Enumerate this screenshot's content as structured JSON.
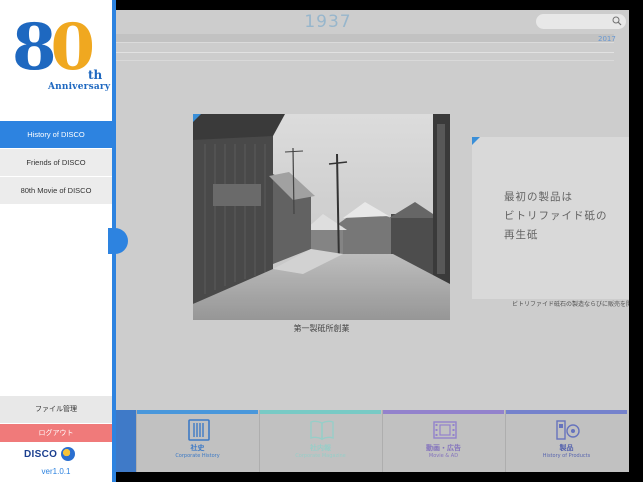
{
  "timeline": {
    "year": "1937",
    "end_year": "2017"
  },
  "photo": {
    "caption": "第一製砥所創業"
  },
  "card": {
    "lines": [
      "最初の製品は",
      "ビトリファイド砥の",
      "再生砥"
    ],
    "subtext": "ビトリファイド砥石の製造ならびに販売を開"
  },
  "tabs": [
    {
      "jp": "社史",
      "en": "Corporate History",
      "icon": "book-icon",
      "color": "#3a8fd8"
    },
    {
      "jp": "社内報",
      "en": "Corporate Magazine",
      "icon": "open-book-icon",
      "color": "#6dc6c0"
    },
    {
      "jp": "動画・広告",
      "en": "Movie & AD",
      "icon": "film-icon",
      "color": "#8a78c8"
    },
    {
      "jp": "製品",
      "en": "History of Products",
      "icon": "products-icon",
      "color": "#6a78c8"
    }
  ],
  "sidebar": {
    "logo": {
      "number": "80",
      "suffix": "th",
      "word": "Anniversary"
    },
    "nav": [
      {
        "label": "History of DISCO",
        "active": true
      },
      {
        "label": "Friends of DISCO",
        "active": false
      },
      {
        "label": "80th Movie of DISCO",
        "active": false
      }
    ],
    "file_mgmt": "ファイル管理",
    "logout": "ログアウト",
    "brand": "DISCO",
    "version": "ver1.0.1"
  },
  "colors": {
    "accent": "#2d83e0",
    "logout": "#f07a7a",
    "logo_orange": "#f0a820"
  }
}
